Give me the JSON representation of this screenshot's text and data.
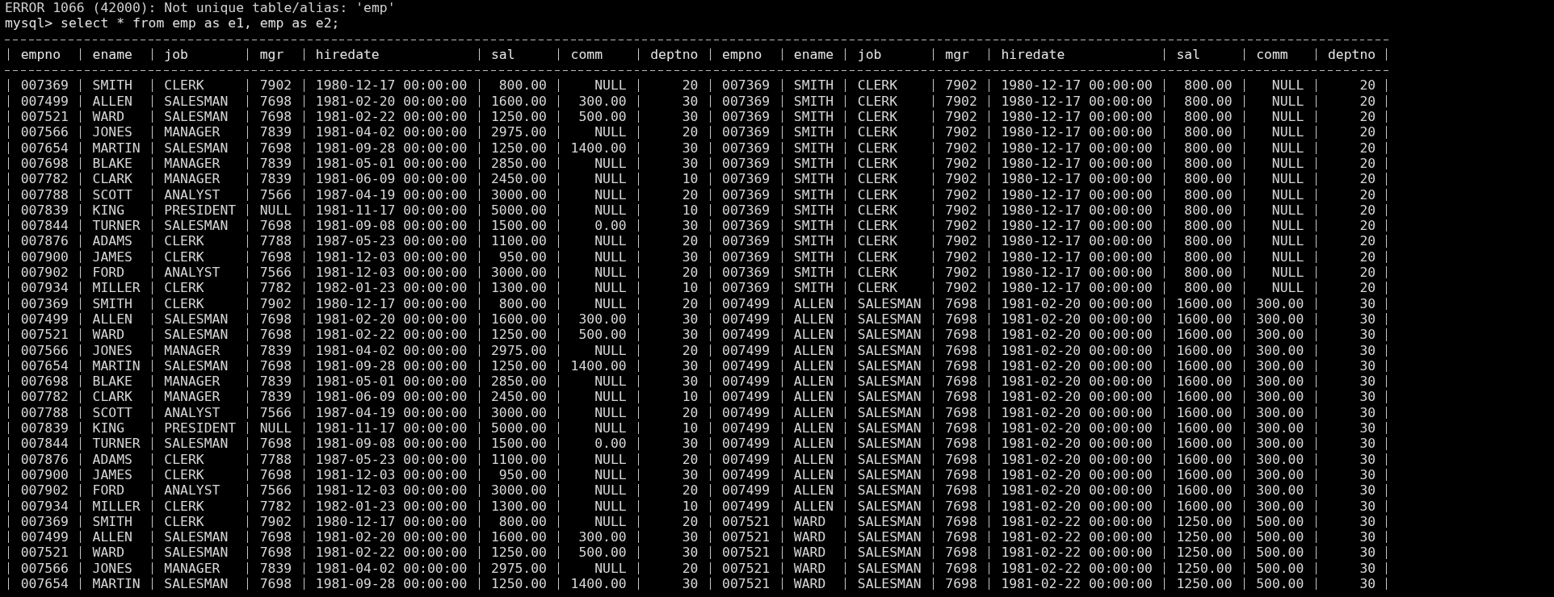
{
  "terminal": {
    "lines": [
      {
        "kind": "error",
        "text": "ERROR 1066 (42000): Not unique table/alias: 'emp'"
      },
      {
        "kind": "prompt",
        "text": "mysql> select * from emp as e1, emp as e2;"
      }
    ]
  },
  "table": {
    "columns": [
      {
        "label": "empno",
        "kind": "text"
      },
      {
        "label": "ename",
        "kind": "text"
      },
      {
        "label": "job",
        "kind": "text"
      },
      {
        "label": "mgr",
        "kind": "text"
      },
      {
        "label": "hiredate",
        "kind": "text"
      },
      {
        "label": "sal",
        "kind": "number"
      },
      {
        "label": "comm",
        "kind": "number"
      },
      {
        "label": "deptno",
        "kind": "number"
      },
      {
        "label": "empno",
        "kind": "text"
      },
      {
        "label": "ename",
        "kind": "text"
      },
      {
        "label": "job",
        "kind": "text"
      },
      {
        "label": "mgr",
        "kind": "text"
      },
      {
        "label": "hiredate",
        "kind": "text"
      },
      {
        "label": "sal",
        "kind": "number"
      },
      {
        "label": "comm",
        "kind": "number"
      },
      {
        "label": "deptno",
        "kind": "number"
      }
    ],
    "rows": [
      [
        "007369",
        "SMITH",
        "CLERK",
        "7902",
        "1980-12-17 00:00:00",
        "800.00",
        "NULL",
        "20",
        "007369",
        "SMITH",
        "CLERK",
        "7902",
        "1980-12-17 00:00:00",
        "800.00",
        "NULL",
        "20"
      ],
      [
        "007499",
        "ALLEN",
        "SALESMAN",
        "7698",
        "1981-02-20 00:00:00",
        "1600.00",
        "300.00",
        "30",
        "007369",
        "SMITH",
        "CLERK",
        "7902",
        "1980-12-17 00:00:00",
        "800.00",
        "NULL",
        "20"
      ],
      [
        "007521",
        "WARD",
        "SALESMAN",
        "7698",
        "1981-02-22 00:00:00",
        "1250.00",
        "500.00",
        "30",
        "007369",
        "SMITH",
        "CLERK",
        "7902",
        "1980-12-17 00:00:00",
        "800.00",
        "NULL",
        "20"
      ],
      [
        "007566",
        "JONES",
        "MANAGER",
        "7839",
        "1981-04-02 00:00:00",
        "2975.00",
        "NULL",
        "20",
        "007369",
        "SMITH",
        "CLERK",
        "7902",
        "1980-12-17 00:00:00",
        "800.00",
        "NULL",
        "20"
      ],
      [
        "007654",
        "MARTIN",
        "SALESMAN",
        "7698",
        "1981-09-28 00:00:00",
        "1250.00",
        "1400.00",
        "30",
        "007369",
        "SMITH",
        "CLERK",
        "7902",
        "1980-12-17 00:00:00",
        "800.00",
        "NULL",
        "20"
      ],
      [
        "007698",
        "BLAKE",
        "MANAGER",
        "7839",
        "1981-05-01 00:00:00",
        "2850.00",
        "NULL",
        "30",
        "007369",
        "SMITH",
        "CLERK",
        "7902",
        "1980-12-17 00:00:00",
        "800.00",
        "NULL",
        "20"
      ],
      [
        "007782",
        "CLARK",
        "MANAGER",
        "7839",
        "1981-06-09 00:00:00",
        "2450.00",
        "NULL",
        "10",
        "007369",
        "SMITH",
        "CLERK",
        "7902",
        "1980-12-17 00:00:00",
        "800.00",
        "NULL",
        "20"
      ],
      [
        "007788",
        "SCOTT",
        "ANALYST",
        "7566",
        "1987-04-19 00:00:00",
        "3000.00",
        "NULL",
        "20",
        "007369",
        "SMITH",
        "CLERK",
        "7902",
        "1980-12-17 00:00:00",
        "800.00",
        "NULL",
        "20"
      ],
      [
        "007839",
        "KING",
        "PRESIDENT",
        "NULL",
        "1981-11-17 00:00:00",
        "5000.00",
        "NULL",
        "10",
        "007369",
        "SMITH",
        "CLERK",
        "7902",
        "1980-12-17 00:00:00",
        "800.00",
        "NULL",
        "20"
      ],
      [
        "007844",
        "TURNER",
        "SALESMAN",
        "7698",
        "1981-09-08 00:00:00",
        "1500.00",
        "0.00",
        "30",
        "007369",
        "SMITH",
        "CLERK",
        "7902",
        "1980-12-17 00:00:00",
        "800.00",
        "NULL",
        "20"
      ],
      [
        "007876",
        "ADAMS",
        "CLERK",
        "7788",
        "1987-05-23 00:00:00",
        "1100.00",
        "NULL",
        "20",
        "007369",
        "SMITH",
        "CLERK",
        "7902",
        "1980-12-17 00:00:00",
        "800.00",
        "NULL",
        "20"
      ],
      [
        "007900",
        "JAMES",
        "CLERK",
        "7698",
        "1981-12-03 00:00:00",
        "950.00",
        "NULL",
        "30",
        "007369",
        "SMITH",
        "CLERK",
        "7902",
        "1980-12-17 00:00:00",
        "800.00",
        "NULL",
        "20"
      ],
      [
        "007902",
        "FORD",
        "ANALYST",
        "7566",
        "1981-12-03 00:00:00",
        "3000.00",
        "NULL",
        "20",
        "007369",
        "SMITH",
        "CLERK",
        "7902",
        "1980-12-17 00:00:00",
        "800.00",
        "NULL",
        "20"
      ],
      [
        "007934",
        "MILLER",
        "CLERK",
        "7782",
        "1982-01-23 00:00:00",
        "1300.00",
        "NULL",
        "10",
        "007369",
        "SMITH",
        "CLERK",
        "7902",
        "1980-12-17 00:00:00",
        "800.00",
        "NULL",
        "20"
      ],
      [
        "007369",
        "SMITH",
        "CLERK",
        "7902",
        "1980-12-17 00:00:00",
        "800.00",
        "NULL",
        "20",
        "007499",
        "ALLEN",
        "SALESMAN",
        "7698",
        "1981-02-20 00:00:00",
        "1600.00",
        "300.00",
        "30"
      ],
      [
        "007499",
        "ALLEN",
        "SALESMAN",
        "7698",
        "1981-02-20 00:00:00",
        "1600.00",
        "300.00",
        "30",
        "007499",
        "ALLEN",
        "SALESMAN",
        "7698",
        "1981-02-20 00:00:00",
        "1600.00",
        "300.00",
        "30"
      ],
      [
        "007521",
        "WARD",
        "SALESMAN",
        "7698",
        "1981-02-22 00:00:00",
        "1250.00",
        "500.00",
        "30",
        "007499",
        "ALLEN",
        "SALESMAN",
        "7698",
        "1981-02-20 00:00:00",
        "1600.00",
        "300.00",
        "30"
      ],
      [
        "007566",
        "JONES",
        "MANAGER",
        "7839",
        "1981-04-02 00:00:00",
        "2975.00",
        "NULL",
        "20",
        "007499",
        "ALLEN",
        "SALESMAN",
        "7698",
        "1981-02-20 00:00:00",
        "1600.00",
        "300.00",
        "30"
      ],
      [
        "007654",
        "MARTIN",
        "SALESMAN",
        "7698",
        "1981-09-28 00:00:00",
        "1250.00",
        "1400.00",
        "30",
        "007499",
        "ALLEN",
        "SALESMAN",
        "7698",
        "1981-02-20 00:00:00",
        "1600.00",
        "300.00",
        "30"
      ],
      [
        "007698",
        "BLAKE",
        "MANAGER",
        "7839",
        "1981-05-01 00:00:00",
        "2850.00",
        "NULL",
        "30",
        "007499",
        "ALLEN",
        "SALESMAN",
        "7698",
        "1981-02-20 00:00:00",
        "1600.00",
        "300.00",
        "30"
      ],
      [
        "007782",
        "CLARK",
        "MANAGER",
        "7839",
        "1981-06-09 00:00:00",
        "2450.00",
        "NULL",
        "10",
        "007499",
        "ALLEN",
        "SALESMAN",
        "7698",
        "1981-02-20 00:00:00",
        "1600.00",
        "300.00",
        "30"
      ],
      [
        "007788",
        "SCOTT",
        "ANALYST",
        "7566",
        "1987-04-19 00:00:00",
        "3000.00",
        "NULL",
        "20",
        "007499",
        "ALLEN",
        "SALESMAN",
        "7698",
        "1981-02-20 00:00:00",
        "1600.00",
        "300.00",
        "30"
      ],
      [
        "007839",
        "KING",
        "PRESIDENT",
        "NULL",
        "1981-11-17 00:00:00",
        "5000.00",
        "NULL",
        "10",
        "007499",
        "ALLEN",
        "SALESMAN",
        "7698",
        "1981-02-20 00:00:00",
        "1600.00",
        "300.00",
        "30"
      ],
      [
        "007844",
        "TURNER",
        "SALESMAN",
        "7698",
        "1981-09-08 00:00:00",
        "1500.00",
        "0.00",
        "30",
        "007499",
        "ALLEN",
        "SALESMAN",
        "7698",
        "1981-02-20 00:00:00",
        "1600.00",
        "300.00",
        "30"
      ],
      [
        "007876",
        "ADAMS",
        "CLERK",
        "7788",
        "1987-05-23 00:00:00",
        "1100.00",
        "NULL",
        "20",
        "007499",
        "ALLEN",
        "SALESMAN",
        "7698",
        "1981-02-20 00:00:00",
        "1600.00",
        "300.00",
        "30"
      ],
      [
        "007900",
        "JAMES",
        "CLERK",
        "7698",
        "1981-12-03 00:00:00",
        "950.00",
        "NULL",
        "30",
        "007499",
        "ALLEN",
        "SALESMAN",
        "7698",
        "1981-02-20 00:00:00",
        "1600.00",
        "300.00",
        "30"
      ],
      [
        "007902",
        "FORD",
        "ANALYST",
        "7566",
        "1981-12-03 00:00:00",
        "3000.00",
        "NULL",
        "20",
        "007499",
        "ALLEN",
        "SALESMAN",
        "7698",
        "1981-02-20 00:00:00",
        "1600.00",
        "300.00",
        "30"
      ],
      [
        "007934",
        "MILLER",
        "CLERK",
        "7782",
        "1982-01-23 00:00:00",
        "1300.00",
        "NULL",
        "10",
        "007499",
        "ALLEN",
        "SALESMAN",
        "7698",
        "1981-02-20 00:00:00",
        "1600.00",
        "300.00",
        "30"
      ],
      [
        "007369",
        "SMITH",
        "CLERK",
        "7902",
        "1980-12-17 00:00:00",
        "800.00",
        "NULL",
        "20",
        "007521",
        "WARD",
        "SALESMAN",
        "7698",
        "1981-02-22 00:00:00",
        "1250.00",
        "500.00",
        "30"
      ],
      [
        "007499",
        "ALLEN",
        "SALESMAN",
        "7698",
        "1981-02-20 00:00:00",
        "1600.00",
        "300.00",
        "30",
        "007521",
        "WARD",
        "SALESMAN",
        "7698",
        "1981-02-22 00:00:00",
        "1250.00",
        "500.00",
        "30"
      ],
      [
        "007521",
        "WARD",
        "SALESMAN",
        "7698",
        "1981-02-22 00:00:00",
        "1250.00",
        "500.00",
        "30",
        "007521",
        "WARD",
        "SALESMAN",
        "7698",
        "1981-02-22 00:00:00",
        "1250.00",
        "500.00",
        "30"
      ],
      [
        "007566",
        "JONES",
        "MANAGER",
        "7839",
        "1981-04-02 00:00:00",
        "2975.00",
        "NULL",
        "20",
        "007521",
        "WARD",
        "SALESMAN",
        "7698",
        "1981-02-22 00:00:00",
        "1250.00",
        "500.00",
        "30"
      ],
      [
        "007654",
        "MARTIN",
        "SALESMAN",
        "7698",
        "1981-09-28 00:00:00",
        "1250.00",
        "1400.00",
        "30",
        "007521",
        "WARD",
        "SALESMAN",
        "7698",
        "1981-02-22 00:00:00",
        "1250.00",
        "500.00",
        "30"
      ]
    ]
  }
}
